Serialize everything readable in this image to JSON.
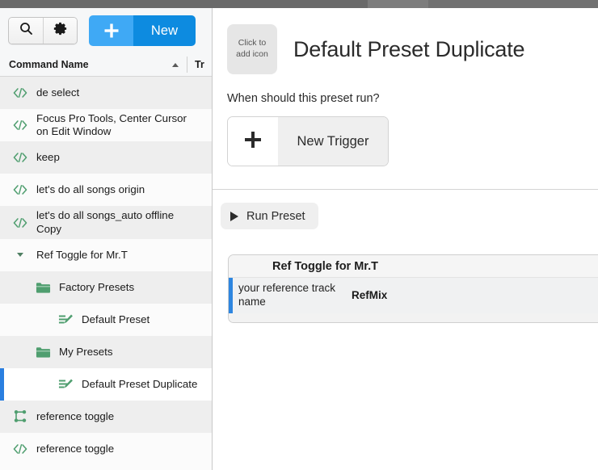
{
  "titlebar": {
    "segments": [
      "",
      "",
      ""
    ]
  },
  "sidebar": {
    "toolbar": {
      "search_icon": "search-icon",
      "settings_icon": "gear-icon",
      "new_plus_icon": "plus-icon",
      "new_label": "New"
    },
    "columns": {
      "name": "Command Name",
      "sort_dir": "ascending",
      "second": "Tr"
    },
    "rows": [
      {
        "label": "de select",
        "icon": "code-icon",
        "indent": 1,
        "style": "alt",
        "selected": false
      },
      {
        "label": "Focus Pro Tools, Center Cursor on Edit Window",
        "icon": "code-icon",
        "indent": 1,
        "style": "plain",
        "selected": false
      },
      {
        "label": "keep",
        "icon": "code-icon",
        "indent": 1,
        "style": "alt",
        "selected": false
      },
      {
        "label": "let's do all songs origin",
        "icon": "code-icon",
        "indent": 1,
        "style": "plain",
        "selected": false
      },
      {
        "label": "let's do all songs_auto offline Copy",
        "icon": "code-icon",
        "indent": 1,
        "style": "alt",
        "selected": false
      },
      {
        "label": "Ref Toggle for Mr.T",
        "icon": "chevron-down-icon",
        "indent": 1,
        "style": "plain",
        "selected": false
      },
      {
        "label": "Factory Presets",
        "icon": "folder-icon",
        "indent": 2,
        "style": "alt",
        "selected": false
      },
      {
        "label": "Default Preset",
        "icon": "preset-icon",
        "indent": 3,
        "style": "plain",
        "selected": false
      },
      {
        "label": "My Presets",
        "icon": "folder-icon",
        "indent": 2,
        "style": "alt",
        "selected": false
      },
      {
        "label": "Default Preset Duplicate",
        "icon": "preset-icon",
        "indent": 3,
        "style": "sel",
        "selected": true
      },
      {
        "label": "reference toggle",
        "icon": "branch-icon",
        "indent": 1,
        "style": "alt",
        "selected": false
      },
      {
        "label": "reference toggle",
        "icon": "code-icon",
        "indent": 1,
        "style": "plain",
        "selected": false
      }
    ]
  },
  "detail": {
    "icon_placeholder_line1": "Click to",
    "icon_placeholder_line2": "add icon",
    "title": "Default Preset Duplicate",
    "when_question": "When should this preset run?",
    "new_trigger_label": "New Trigger",
    "new_trigger_icon": "plus-icon",
    "run_preset_label": "Run Preset",
    "run_preset_icon": "play-icon",
    "card": {
      "header": "Ref Toggle for Mr.T",
      "param_label": "your reference track name",
      "param_value": "RefMix"
    }
  },
  "colors": {
    "accent_blue": "#0d8be0",
    "accent_blue_light": "#3fa9f5",
    "selection_blue": "#2a7fe0",
    "icon_green": "#4f9e6f"
  }
}
